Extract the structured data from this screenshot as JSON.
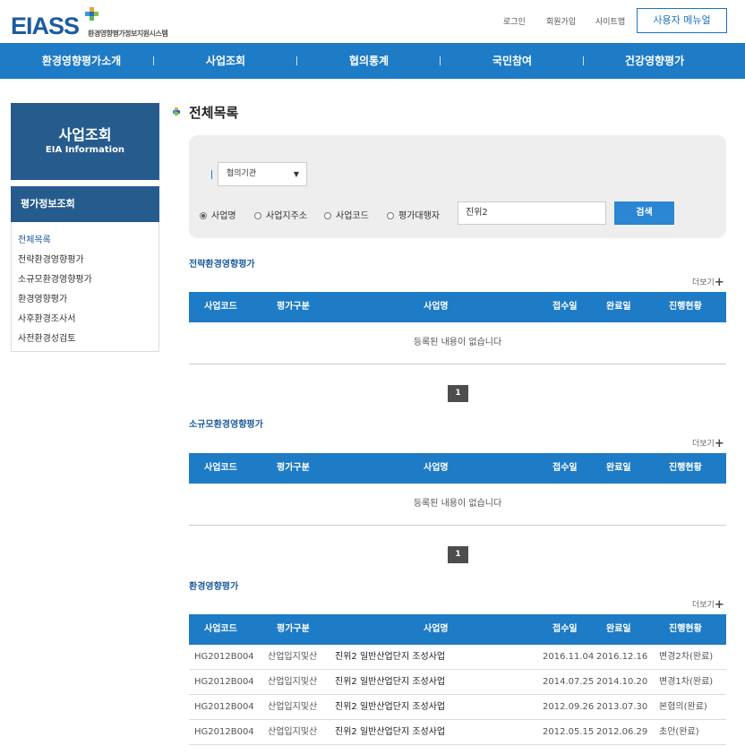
{
  "header": {
    "logo_text": "EIASS",
    "logo_subtitle": "환경영향평가정보지원시스템",
    "util_links": [
      "로그인",
      "회원가입",
      "사이트맵"
    ],
    "user_menu_label": "사용자 메뉴얼"
  },
  "gnb": [
    "환경영향평가소개",
    "사업조회",
    "협의통계",
    "국민참여",
    "건강영향평가"
  ],
  "sidebar": {
    "title": "사업조회",
    "subtitle": "EIA Information",
    "section_title": "평가정보조회",
    "items": [
      "전체목록",
      "전략환경영향평가",
      "소규모환경영향평가",
      "환경영향평가",
      "사후환경조사서",
      "사전환경성검토"
    ]
  },
  "page_title": "전체목록",
  "search": {
    "select_value": "협의기관",
    "radios": [
      "사업명",
      "사업지주소",
      "사업코드",
      "평가대행자"
    ],
    "selected_radio": "사업명",
    "input_value": "진위2",
    "button_label": "검색"
  },
  "table_headers": [
    "사업코드",
    "평가구분",
    "사업명",
    "접수일",
    "완료일",
    "진행현황"
  ],
  "more_label": "더보기",
  "sections": [
    {
      "title": "전략환경영향평가",
      "empty_message": "등록된 내용이 없습니다",
      "page": "1"
    },
    {
      "title": "소규모환경영향평가",
      "empty_message": "등록된 내용이 없습니다",
      "page": "1"
    },
    {
      "title": "환경영향평가",
      "rows": [
        {
          "code": "HG2012B004",
          "type": "산업입지및산",
          "name": "진위2 일반산업단지 조성사업",
          "received": "2016.11.04",
          "completed": "2016.12.16",
          "status": "변경2차(완료)"
        },
        {
          "code": "HG2012B004",
          "type": "산업입지및산",
          "name": "진위2 일반산업단지 조성사업",
          "received": "2014.07.25",
          "completed": "2014.10.20",
          "status": "변경1차(완료)"
        },
        {
          "code": "HG2012B004",
          "type": "산업입지및산",
          "name": "진위2 일반산업단지 조성사업",
          "received": "2012.09.26",
          "completed": "2013.07.30",
          "status": "본협의(완료)"
        },
        {
          "code": "HG2012B004",
          "type": "산업입지및산",
          "name": "진위2 일반산업단지 조성사업",
          "received": "2012.05.15",
          "completed": "2012.06.29",
          "status": "초안(완료)"
        }
      ]
    }
  ]
}
